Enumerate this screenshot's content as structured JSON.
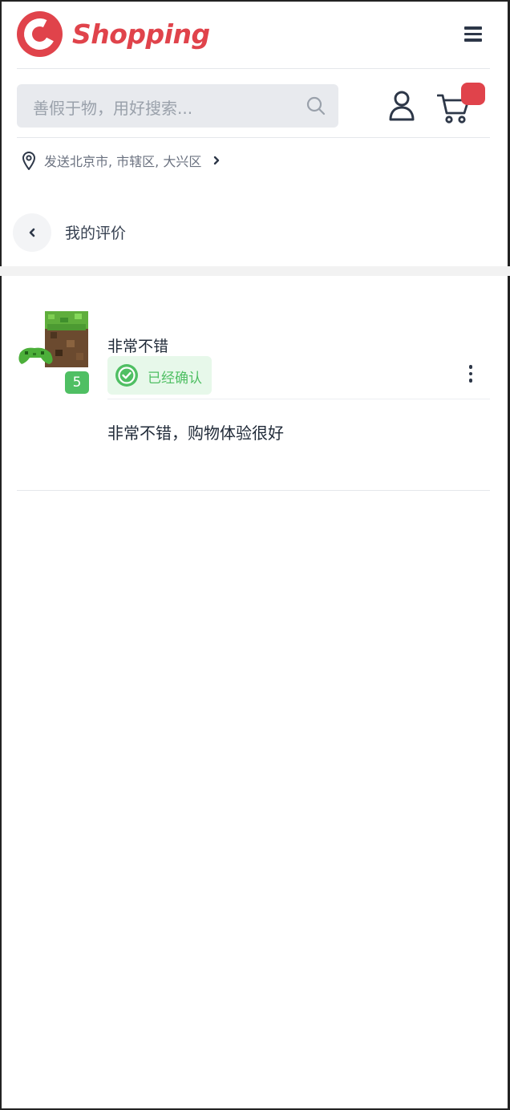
{
  "header": {
    "brand": "Shopping",
    "logo_letter": "C",
    "brand_color": "#e0434b",
    "menu_icon": "hamburger-menu-icon"
  },
  "search": {
    "placeholder": "善假于物，用好搜索...",
    "icon": "search-icon"
  },
  "account": {
    "icon": "user-icon"
  },
  "cart": {
    "icon": "cart-icon",
    "badge_color": "#e0434b"
  },
  "location": {
    "icon": "map-pin-icon",
    "text": "发送北京市, 市辖区, 大兴区"
  },
  "page": {
    "title": "我的评价",
    "back_icon": "chevron-left-icon"
  },
  "reviews": [
    {
      "rating": "5",
      "title": "非常不错",
      "status": "已经确认",
      "status_color": "#4fbf63",
      "body": "非常不错，购物体验很好",
      "thumbnail": "minecraft-xbox-console-image",
      "more_icon": "more-vertical-icon"
    }
  ]
}
